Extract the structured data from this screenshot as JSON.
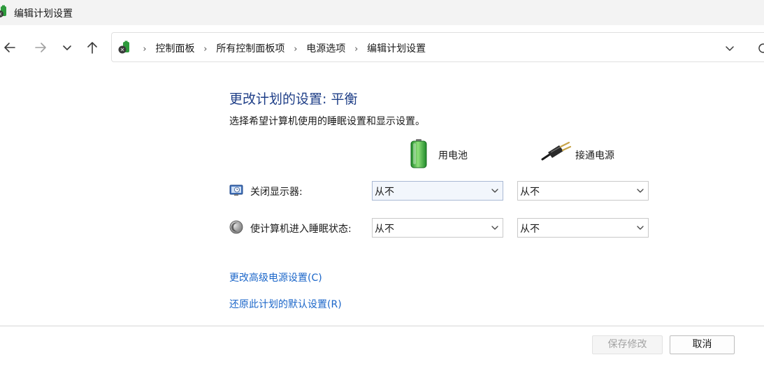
{
  "window": {
    "title": "编辑计划设置"
  },
  "navigation": {
    "breadcrumbs": [
      "控制面板",
      "所有控制面板项",
      "电源选项",
      "编辑计划设置"
    ]
  },
  "main": {
    "heading": "更改计划的设置: 平衡",
    "subheading": "选择希望计算机使用的睡眠设置和显示设置。",
    "columns": {
      "battery": "用电池",
      "plugged_in": "接通电源"
    },
    "settings": [
      {
        "label": "关闭显示器:",
        "battery_value": "从不",
        "plugged_value": "从不"
      },
      {
        "label": "使计算机进入睡眠状态:",
        "battery_value": "从不",
        "plugged_value": "从不"
      }
    ],
    "links": {
      "advanced": "更改高级电源设置(C)",
      "restore": "还原此计划的默认设置(R)"
    }
  },
  "footer": {
    "save_label": "保存修改",
    "cancel_label": "取消"
  },
  "colors": {
    "heading": "#1e3e87",
    "link": "#1b66c9",
    "titlebar_bg": "#f3f3f3"
  },
  "icons": {
    "app": "power-options-icon",
    "back": "arrow-left-icon",
    "forward": "arrow-right-icon",
    "recent": "chevron-down-icon",
    "up": "arrow-up-icon",
    "battery": "battery-icon",
    "plug": "power-plug-icon",
    "display": "display-clock-icon",
    "sleep": "sleep-moon-icon"
  }
}
